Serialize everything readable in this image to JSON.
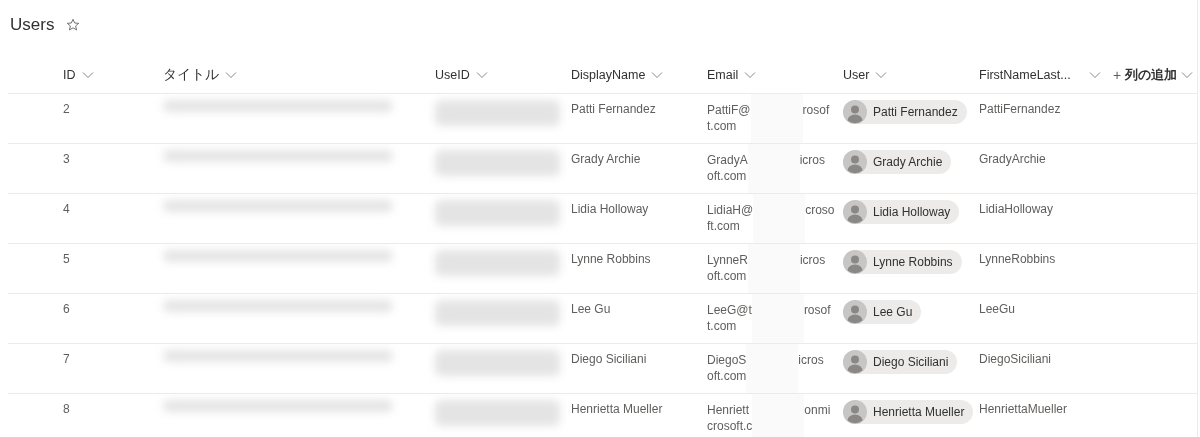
{
  "list_title": "Users",
  "favorite": false,
  "columns": [
    {
      "label": "ID"
    },
    {
      "label": "タイトル"
    },
    {
      "label": "UseID"
    },
    {
      "label": "DisplayName"
    },
    {
      "label": "Email"
    },
    {
      "label": "User"
    },
    {
      "label": "FirstNameLast..."
    }
  ],
  "add_column": {
    "icon": "+",
    "label": "列の追加"
  },
  "rows": [
    {
      "id": "2",
      "display_name": "Patti Fernandez",
      "email_start": "PattiF@",
      "email_end": "rosof",
      "email_line2": "t.com",
      "user": "Patti Fernandez",
      "first_last": "PattiFernandez"
    },
    {
      "id": "3",
      "display_name": "Grady Archie",
      "email_start": "GradyA",
      "email_end": "icros",
      "email_line2": "oft.com",
      "user": "Grady Archie",
      "first_last": "GradyArchie"
    },
    {
      "id": "4",
      "display_name": "Lidia Holloway",
      "email_start": "LidiaH@",
      "email_end": "croso",
      "email_line2": "ft.com",
      "user": "Lidia Holloway",
      "first_last": "LidiaHolloway"
    },
    {
      "id": "5",
      "display_name": "Lynne Robbins",
      "email_start": "LynneR",
      "email_end": "icros",
      "email_line2": "oft.com",
      "user": "Lynne Robbins",
      "first_last": "LynneRobbins"
    },
    {
      "id": "6",
      "display_name": "Lee Gu",
      "email_start": "LeeG@t",
      "email_end": "rosof",
      "email_line2": "t.com",
      "user": "Lee Gu",
      "first_last": "LeeGu"
    },
    {
      "id": "7",
      "display_name": "Diego Siciliani",
      "email_start": "DiegoS",
      "email_end": "icros",
      "email_line2": "oft.com",
      "user": "Diego Siciliani",
      "first_last": "DiegoSiciliani"
    },
    {
      "id": "8",
      "display_name": "Henrietta Mueller",
      "email_start": "Henriett",
      "email_end": "onmi",
      "email_line2": "crosoft.c",
      "user": "Henrietta Mueller",
      "first_last": "HenriettaMueller"
    }
  ]
}
